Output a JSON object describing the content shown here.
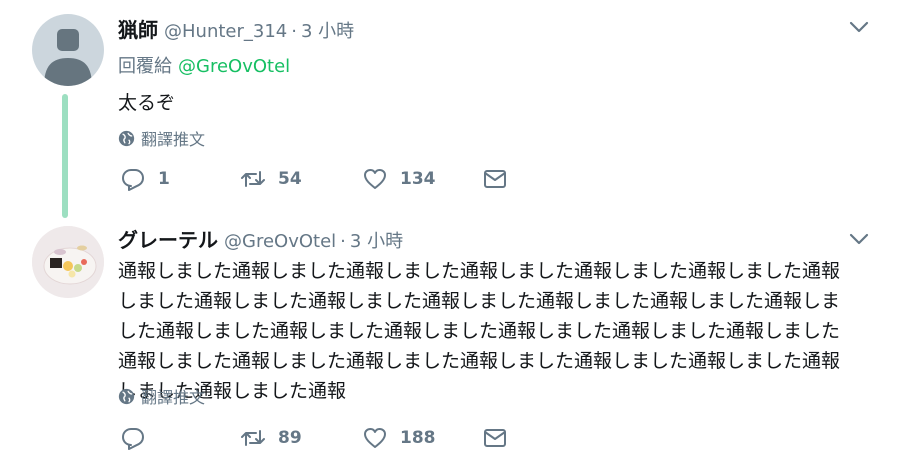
{
  "colors": {
    "text_primary": "#14171a",
    "text_secondary": "#657786",
    "mention_green": "#17bf63",
    "thread_line": "#9ddfc1",
    "background": "#ffffff"
  },
  "tweets": [
    {
      "display_name": "猟師",
      "handle": "@Hunter_314",
      "separator": "·",
      "time": "3 小時",
      "reply_prefix": "回覆給",
      "reply_mention": "@GreOvOtel",
      "text": "太るぞ",
      "translate_label": "翻譯推文",
      "reply_count": "1",
      "retweet_count": "54",
      "like_count": "134",
      "icons": [
        "default-avatar",
        "chevron-down-icon",
        "globe-icon",
        "reply-icon",
        "retweet-icon",
        "like-icon",
        "message-icon"
      ]
    },
    {
      "display_name": "グレーテル",
      "handle": "@GreOvOtel",
      "separator": "·",
      "time": "3 小時",
      "text": "通報しました通報しました通報しました通報しました通報しました通報しました通報しました通報しました通報しました通報しました通報しました通報しました通報しました通報しました通報しました通報しました通報しました通報しました通報しました通報しました通報しました通報しました通報しました通報しました通報しました通報しました通報しました通報",
      "translate_label": "翻譯推文",
      "reply_count": "",
      "retweet_count": "89",
      "like_count": "188",
      "icons": [
        "food-photo-avatar",
        "chevron-down-icon",
        "globe-icon",
        "reply-icon",
        "retweet-icon",
        "like-icon",
        "message-icon"
      ]
    }
  ]
}
